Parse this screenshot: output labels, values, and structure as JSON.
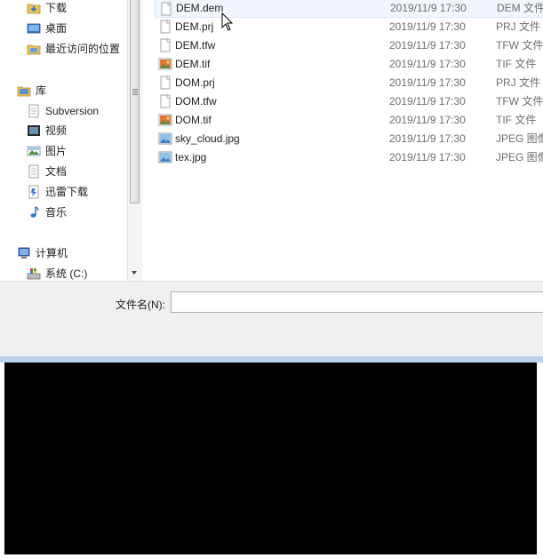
{
  "nav": {
    "items": [
      {
        "label": "下载",
        "icon": "downloads-folder-icon"
      },
      {
        "label": "桌面",
        "icon": "desktop-icon"
      },
      {
        "label": "最近访问的位置",
        "icon": "recent-places-icon"
      },
      {
        "label": "库",
        "icon": "libraries-icon"
      },
      {
        "label": "Subversion",
        "icon": "document-library-icon"
      },
      {
        "label": "视频",
        "icon": "video-library-icon"
      },
      {
        "label": "图片",
        "icon": "picture-library-icon"
      },
      {
        "label": "文档",
        "icon": "document-library-icon"
      },
      {
        "label": "迅雷下载",
        "icon": "thunder-download-icon"
      },
      {
        "label": "音乐",
        "icon": "music-library-icon"
      },
      {
        "label": "计算机",
        "icon": "computer-icon"
      },
      {
        "label": "系统 (C:)",
        "icon": "system-drive-icon"
      }
    ]
  },
  "files": [
    {
      "name": "DEM.dem",
      "date": "2019/11/9 17:30",
      "type": "DEM 文件",
      "icon": "blank-file-icon"
    },
    {
      "name": "DEM.prj",
      "date": "2019/11/9 17:30",
      "type": "PRJ 文件",
      "icon": "blank-file-icon"
    },
    {
      "name": "DEM.tfw",
      "date": "2019/11/9 17:30",
      "type": "TFW 文件",
      "icon": "blank-file-icon"
    },
    {
      "name": "DEM.tif",
      "date": "2019/11/9 17:30",
      "type": "TIF 文件",
      "icon": "tif-image-icon"
    },
    {
      "name": "DOM.prj",
      "date": "2019/11/9 17:30",
      "type": "PRJ 文件",
      "icon": "blank-file-icon"
    },
    {
      "name": "DOM.tfw",
      "date": "2019/11/9 17:30",
      "type": "TFW 文件",
      "icon": "blank-file-icon"
    },
    {
      "name": "DOM.tif",
      "date": "2019/11/9 17:30",
      "type": "TIF 文件",
      "icon": "tif-image-icon"
    },
    {
      "name": "sky_cloud.jpg",
      "date": "2019/11/9 17:30",
      "type": "JPEG 图像",
      "icon": "jpeg-image-icon"
    },
    {
      "name": "tex.jpg",
      "date": "2019/11/9 17:30",
      "type": "JPEG 图像",
      "icon": "jpeg-image-icon"
    }
  ],
  "filename": {
    "label": "文件名(N):",
    "value": ""
  },
  "colors": {
    "selection": "#f0f6fc",
    "window_border": "#b9d1ea"
  }
}
